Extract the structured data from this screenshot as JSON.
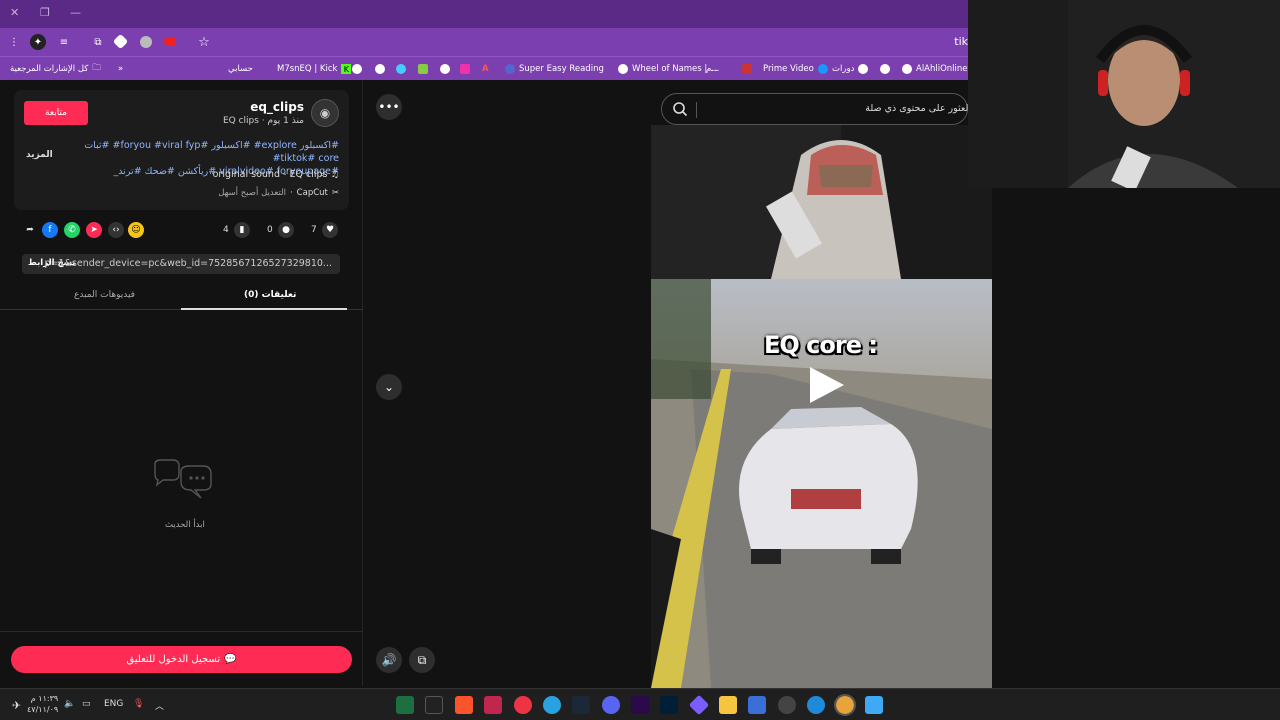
{
  "browser": {
    "url_fragment": "tik",
    "bookmarks": [
      {
        "label": "كل الإشارات المرجعية"
      },
      {
        "label": "حسابي"
      },
      {
        "label": "M7snEQ | Kick"
      },
      {
        "label": "Super Easy Reading"
      },
      {
        "label": "Wheel of Names | ..."
      },
      {
        "label": "م..."
      },
      {
        "label": "Prime Video"
      },
      {
        "label": "دورات"
      },
      {
        "label": "AlAhliOnline"
      }
    ]
  },
  "post": {
    "follow_label": "متابعة",
    "username": "eq_clips",
    "subline": "EQ clips · منذ 1 يوم",
    "more_label": "المزيد",
    "hashtags_line1": "#اكسبلور explore# #اكسبلور #foryou #viral fyp# #ثبات tiktok# core#",
    "hashtags_line2": "#viralvideo# foryoupage #ريأكشن #ضحك #ترند_",
    "sound": "original sound - EQ clips",
    "capcut_label": "CapCut",
    "capcut_desc": "التعديل أصبح أسهل",
    "likes": "7",
    "comments": "0",
    "saves": "4",
    "link": "p=1&sender_device=pc&web_id=7528567126527329810...",
    "copy_label": "نسخ الرابط",
    "tab_comments": "تعليقات (0)",
    "tab_creator_videos": "فيديوهات المبدع",
    "empty_text": "ابدأ الحديث",
    "login_label": "تسجيل الدخول للتعليق"
  },
  "search": {
    "placeholder": "العثور على محتوى ذي صلة"
  },
  "video": {
    "overlay_title": "EQ core :"
  },
  "taskbar": {
    "lang": "ENG",
    "time": "١١:٣٩ م",
    "date": "٤٧/١١/٠٩"
  },
  "colors": {
    "accent": "#fe2c55",
    "browser_purple": "#7b3fb0",
    "titlebar_purple": "#5b2a86"
  }
}
